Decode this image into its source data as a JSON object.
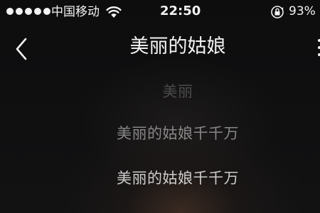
{
  "status_bar": {
    "carrier": "中国移动",
    "time": "22:50",
    "battery": "93%",
    "signal_strength": 5,
    "icons": [
      "wifi-icon",
      "rotation-lock-icon"
    ]
  },
  "nav": {
    "title": "美丽的姑娘",
    "back_icon": "chevron-left-icon",
    "more_icon": "more-icon"
  },
  "lyrics": [
    "美丽",
    "美丽的姑娘千千万",
    "美丽的姑娘千千万"
  ],
  "colors": {
    "background": "#0c0c0d",
    "text": "#f4f4f4",
    "glow": "#5c3e2e"
  }
}
